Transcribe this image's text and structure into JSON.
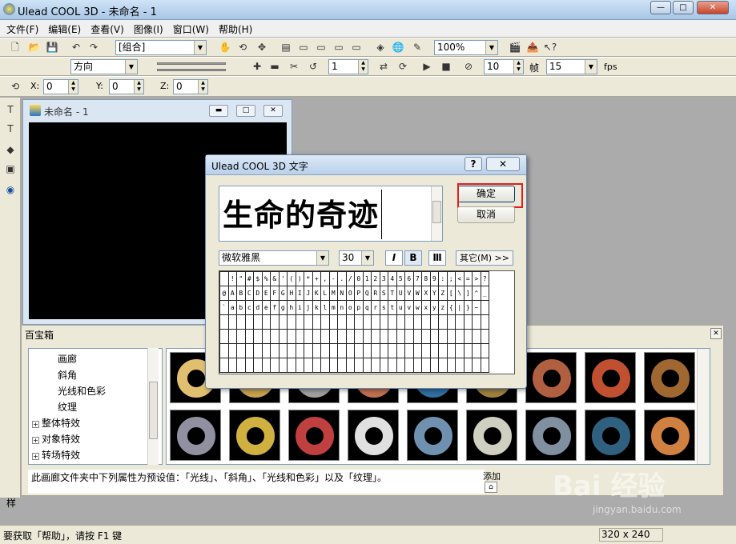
{
  "app": {
    "title": "Ulead COOL 3D - 未命名 - 1",
    "min_icon": "minimize-icon",
    "max_icon": "maximize-icon",
    "close_icon": "close-icon",
    "min": "—",
    "max": "□",
    "close": "✕"
  },
  "menu": [
    "文件(F)",
    "编辑(E)",
    "查看(V)",
    "图像(I)",
    "窗口(W)",
    "帮助(H)"
  ],
  "toolbar1": {
    "combo": "[组合]",
    "zoom": "100%"
  },
  "toolbar2": {
    "direction": "方向",
    "frame_value": "1",
    "frames_value": "10",
    "frame_label": "帧",
    "fps_value": "15",
    "fps_label": "fps"
  },
  "toolbar3": {
    "x_label": "X:",
    "x_value": "0",
    "y_label": "Y:",
    "y_value": "0",
    "z_label": "Z:",
    "z_value": "0"
  },
  "child_window": {
    "title": "未命名 - 1"
  },
  "baobao": {
    "title": "百宝箱",
    "close": "✕",
    "tree": [
      {
        "label": "画廊",
        "indent": 2
      },
      {
        "label": "斜角",
        "indent": 2
      },
      {
        "label": "光线和色彩",
        "indent": 2
      },
      {
        "label": "纹理",
        "indent": 2
      },
      {
        "label": "整体特效",
        "indent": 0,
        "expand": "+"
      },
      {
        "label": "对象特效",
        "indent": 0,
        "expand": "+"
      },
      {
        "label": "转场特效",
        "indent": 0,
        "expand": "+"
      }
    ],
    "thumbs_row1": [
      "#e0c070",
      "#c8a050",
      "#a0a0a0",
      "#c07050",
      "#3070a0",
      "#a08040",
      "#b06040",
      "#c05030",
      "#a06830",
      "#c8b090"
    ],
    "thumbs_row2": [
      "#9090a0",
      "#d0b040",
      "#c04040",
      "#e0e0e0",
      "#7090b0",
      "#d0d0c0",
      "#8090a0",
      "#306080",
      "#d08040",
      "#8a8a8a"
    ],
    "description": "此画廊文件夹中下列属性为预设值：「光线」、「斜角」、「光线和色彩」以及「纹理」。",
    "add_label": "添加",
    "side_label": "样"
  },
  "status": {
    "help": "要获取「帮助」，请按 F1 键",
    "size": "320 x 240"
  },
  "dialog": {
    "title": "Ulead COOL 3D 文字",
    "help": "?",
    "close": "✕",
    "text": "生命的奇迹",
    "ok": "确定",
    "cancel": "取消",
    "font": "微软雅黑",
    "size": "30",
    "italic": "I",
    "bold": "B",
    "other": "其它(M) >>",
    "chars_row1": [
      " ",
      "!",
      "\"",
      "#",
      "$",
      "%",
      "&",
      "'",
      "(",
      ")",
      "*",
      "+",
      ",",
      "-",
      ".",
      "/",
      "0",
      "1",
      "2",
      "3",
      "4",
      "5",
      "6",
      "7",
      "8",
      "9",
      ":",
      ";",
      "<",
      "=",
      ">",
      "?"
    ],
    "chars_row2": [
      "@",
      "A",
      "B",
      "C",
      "D",
      "E",
      "F",
      "G",
      "H",
      "I",
      "J",
      "K",
      "L",
      "M",
      "N",
      "O",
      "P",
      "Q",
      "R",
      "S",
      "T",
      "U",
      "V",
      "W",
      "X",
      "Y",
      "Z",
      "[",
      "\\",
      "]",
      "^",
      "_"
    ],
    "chars_row3": [
      "`",
      "a",
      "b",
      "c",
      "d",
      "e",
      "f",
      "g",
      "h",
      "i",
      "j",
      "k",
      "l",
      "m",
      "n",
      "o",
      "p",
      "q",
      "r",
      "s",
      "t",
      "u",
      "v",
      "w",
      "x",
      "y",
      "z",
      "{",
      "|",
      "}",
      "~",
      ""
    ]
  },
  "watermark": {
    "brand": "Bai 经验",
    "url": "jingyan.baidu.com"
  }
}
